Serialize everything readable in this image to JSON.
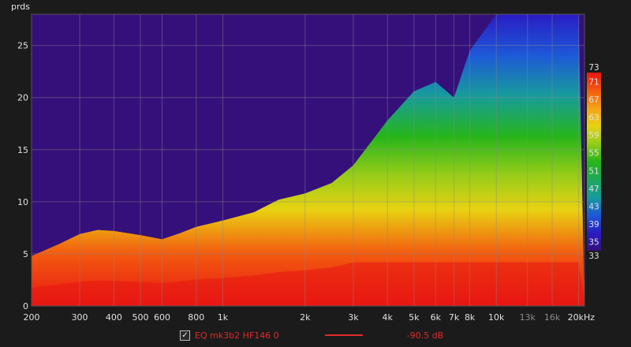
{
  "chart_data": {
    "type": "heatmap",
    "title": "",
    "xlabel": "",
    "ylabel": "prds",
    "xscale": "log",
    "xlim": [
      200,
      21000
    ],
    "ylim": [
      0,
      28
    ],
    "x_ticks": [
      {
        "value": 200,
        "label": "200"
      },
      {
        "value": 300,
        "label": "300"
      },
      {
        "value": 400,
        "label": "400"
      },
      {
        "value": 500,
        "label": "500"
      },
      {
        "value": 600,
        "label": "600"
      },
      {
        "value": 800,
        "label": "800"
      },
      {
        "value": 1000,
        "label": "1k"
      },
      {
        "value": 2000,
        "label": "2k"
      },
      {
        "value": 3000,
        "label": "3k"
      },
      {
        "value": 4000,
        "label": "4k"
      },
      {
        "value": 5000,
        "label": "5k"
      },
      {
        "value": 6000,
        "label": "6k"
      },
      {
        "value": 7000,
        "label": "7k"
      },
      {
        "value": 8000,
        "label": "8k"
      },
      {
        "value": 10000,
        "label": "10k"
      },
      {
        "value": 13000,
        "label": "13k",
        "dim": true
      },
      {
        "value": 16000,
        "label": "16k",
        "dim": true
      },
      {
        "value": 20000,
        "label": "20kHz"
      }
    ],
    "y_ticks": [
      0,
      5,
      10,
      15,
      20,
      25
    ],
    "grid": true,
    "colorbar": {
      "min": 33,
      "max": 73,
      "ticks": [
        73,
        71,
        67,
        63,
        59,
        55,
        51,
        47,
        43,
        39,
        35,
        33
      ],
      "colors": [
        "#35107a",
        "#2a1cc4",
        "#1d58d8",
        "#179c9b",
        "#1fa85c",
        "#27b51a",
        "#96cc19",
        "#e8d212",
        "#f5a317",
        "#f35b10",
        "#e81612"
      ]
    },
    "decay_envelope": [
      {
        "freq": 200,
        "periods": 4.8
      },
      {
        "freq": 250,
        "periods": 5.9
      },
      {
        "freq": 300,
        "periods": 6.9
      },
      {
        "freq": 350,
        "periods": 7.3
      },
      {
        "freq": 400,
        "periods": 7.2
      },
      {
        "freq": 500,
        "periods": 6.8
      },
      {
        "freq": 600,
        "periods": 6.4
      },
      {
        "freq": 700,
        "periods": 7.0
      },
      {
        "freq": 800,
        "periods": 7.6
      },
      {
        "freq": 1000,
        "periods": 8.2
      },
      {
        "freq": 1300,
        "periods": 9.0
      },
      {
        "freq": 1600,
        "periods": 10.2
      },
      {
        "freq": 2000,
        "periods": 10.8
      },
      {
        "freq": 2500,
        "periods": 11.8
      },
      {
        "freq": 3000,
        "periods": 13.5
      },
      {
        "freq": 4000,
        "periods": 17.8
      },
      {
        "freq": 5000,
        "periods": 20.6
      },
      {
        "freq": 6000,
        "periods": 21.5
      },
      {
        "freq": 7000,
        "periods": 20.0
      },
      {
        "freq": 8000,
        "periods": 24.5
      },
      {
        "freq": 10000,
        "periods": 28
      },
      {
        "freq": 13000,
        "periods": 28
      },
      {
        "freq": 16000,
        "periods": 28
      },
      {
        "freq": 20000,
        "periods": 28
      }
    ]
  },
  "legend": {
    "checked": true,
    "check_glyph": "✓",
    "name": "EQ mk3b2 HF146 0",
    "line_color": "#e02a2a",
    "value": "-90.5 dB"
  }
}
